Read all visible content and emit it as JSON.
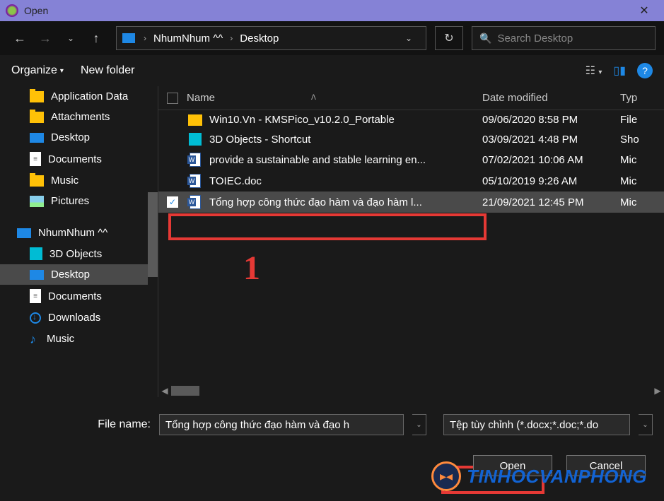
{
  "title": "Open",
  "breadcrumbs": [
    "NhumNhum ^^",
    "Desktop"
  ],
  "search_placeholder": "Search Desktop",
  "organize_label": "Organize",
  "new_folder_label": "New folder",
  "sidebar": [
    {
      "icon": "folder",
      "label": "Application Data"
    },
    {
      "icon": "folder",
      "label": "Attachments"
    },
    {
      "icon": "monitor",
      "label": "Desktop"
    },
    {
      "icon": "doc",
      "label": "Documents"
    },
    {
      "icon": "folder",
      "label": "Music"
    },
    {
      "icon": "pic",
      "label": "Pictures"
    },
    {
      "icon": "monitor",
      "label": "NhumNhum ^^",
      "header": true
    },
    {
      "icon": "3d",
      "label": "3D Objects"
    },
    {
      "icon": "monitor",
      "label": "Desktop",
      "selected": true
    },
    {
      "icon": "doc",
      "label": "Documents"
    },
    {
      "icon": "dl",
      "label": "Downloads"
    },
    {
      "icon": "music",
      "label": "Music"
    }
  ],
  "columns": {
    "name": "Name",
    "date": "Date modified",
    "type": "Typ"
  },
  "files": [
    {
      "icon": "fold",
      "name": "Win10.Vn - KMSPico_v10.2.0_Portable",
      "date": "09/06/2020 8:58 PM",
      "type": "File"
    },
    {
      "icon": "cube",
      "name": "3D Objects - Shortcut",
      "date": "03/09/2021 4:48 PM",
      "type": "Sho"
    },
    {
      "icon": "word",
      "name": "provide a sustainable and stable learning en...",
      "date": "07/02/2021 10:06 AM",
      "type": "Mic"
    },
    {
      "icon": "word",
      "name": "TOIEC.doc",
      "date": "05/10/2019 9:26 AM",
      "type": "Mic"
    },
    {
      "icon": "word",
      "name": "Tổng hợp công thức đạo hàm và đạo hàm l...",
      "date": "21/09/2021 12:45 PM",
      "type": "Mic",
      "selected": true,
      "checked": true
    }
  ],
  "filename_label": "File name:",
  "filename_value": "Tổng hợp công thức đạo hàm và đạo h",
  "filter_value": "Tệp tùy chỉnh (*.docx;*.doc;*.do",
  "open_label": "Open",
  "cancel_label": "Cancel",
  "annotation_1": "1",
  "watermark": "TINHOCVANPHONG"
}
